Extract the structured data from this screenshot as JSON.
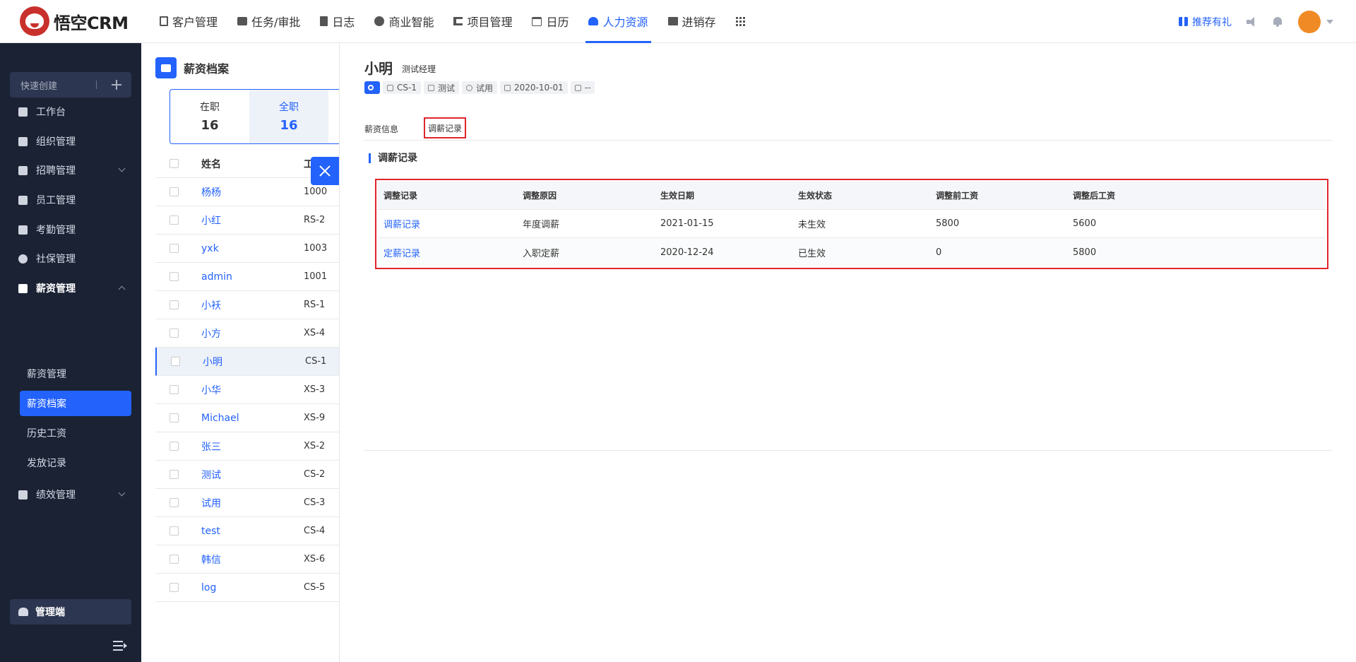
{
  "app": {
    "logo_text": "悟空CRM"
  },
  "topnav": {
    "items": [
      {
        "label": "客户管理",
        "icon": "building-icon"
      },
      {
        "label": "任务/审批",
        "icon": "briefcase-icon"
      },
      {
        "label": "日志",
        "icon": "log-icon"
      },
      {
        "label": "商业智能",
        "icon": "cube-icon"
      },
      {
        "label": "项目管理",
        "icon": "project-icon"
      },
      {
        "label": "日历",
        "icon": "calendar-icon"
      },
      {
        "label": "人力资源",
        "icon": "people-icon",
        "active": true
      },
      {
        "label": "进销存",
        "icon": "inventory-icon"
      }
    ],
    "recommend_label": "推荐有礼"
  },
  "sidebar": {
    "quick_create": "快速创建",
    "items": [
      {
        "label": "工作台"
      },
      {
        "label": "组织管理"
      },
      {
        "label": "招聘管理"
      },
      {
        "label": "员工管理"
      },
      {
        "label": "考勤管理"
      },
      {
        "label": "社保管理"
      },
      {
        "label": "薪资管理"
      },
      {
        "label": "绩效管理"
      }
    ],
    "sub_items": [
      {
        "label": "薪资管理"
      },
      {
        "label": "薪资档案"
      },
      {
        "label": "历史工资"
      },
      {
        "label": "发放记录"
      }
    ],
    "admin_label": "管理端"
  },
  "list": {
    "page_title": "薪资档案",
    "stats": [
      {
        "label": "在职",
        "value": "16"
      },
      {
        "label": "全职",
        "value": "16"
      }
    ],
    "headers": [
      "姓名",
      "工"
    ],
    "rows": [
      {
        "name": "杨杨",
        "code": "1000"
      },
      {
        "name": "小红",
        "code": "RS-2"
      },
      {
        "name": "yxk",
        "code": "1003"
      },
      {
        "name": "admin",
        "code": "1001"
      },
      {
        "name": "小袄",
        "code": "RS-1"
      },
      {
        "name": "小方",
        "code": "XS-4"
      },
      {
        "name": "小明",
        "code": "CS-1"
      },
      {
        "name": "小华",
        "code": "XS-3"
      },
      {
        "name": "Michael",
        "code": "XS-9"
      },
      {
        "name": "张三",
        "code": "XS-2"
      },
      {
        "name": "测试",
        "code": "CS-2"
      },
      {
        "name": "试用",
        "code": "CS-3"
      },
      {
        "name": "test",
        "code": "CS-4"
      },
      {
        "name": "韩信",
        "code": "XS-6"
      },
      {
        "name": "log",
        "code": "CS-5"
      }
    ]
  },
  "detail": {
    "name": "小明",
    "title": "测试经理",
    "tags": [
      "CS-1",
      "测试",
      "试用",
      "2020-10-01",
      "--"
    ],
    "tabs": [
      "薪资信息",
      "调薪记录"
    ],
    "section_title": "调薪记录",
    "table": {
      "headers": [
        "调整记录",
        "调整原因",
        "生效日期",
        "生效状态",
        "调整前工资",
        "调整后工资"
      ],
      "rows": [
        [
          "调薪记录",
          "年度调薪",
          "2021-01-15",
          "未生效",
          "5800",
          "5600"
        ],
        [
          "定薪记录",
          "入职定薪",
          "2020-12-24",
          "已生效",
          "0",
          "5800"
        ]
      ]
    }
  }
}
